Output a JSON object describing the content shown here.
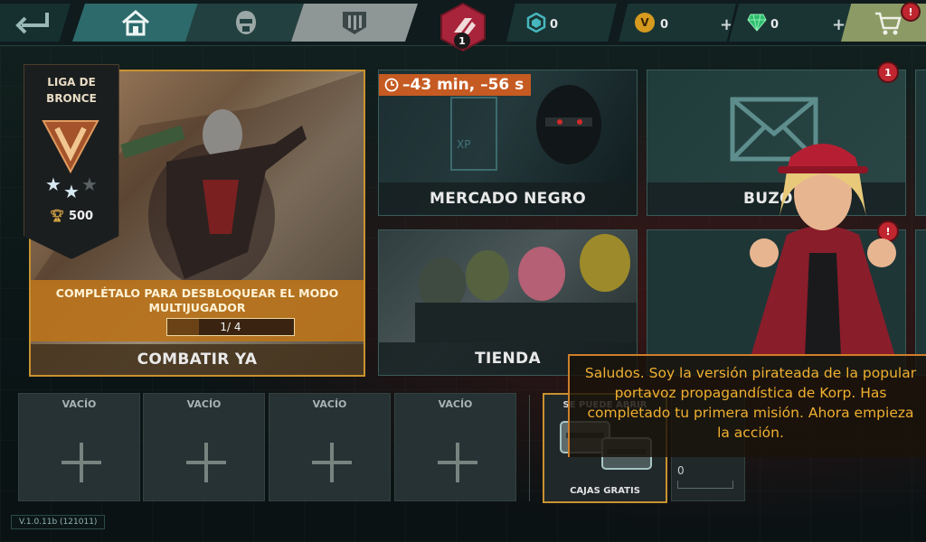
{
  "topbar": {
    "currencies": [
      {
        "name": "tokens",
        "value": "0",
        "color": "#3fa9b0"
      },
      {
        "name": "gold",
        "value": "0",
        "color": "#d59a1e"
      },
      {
        "name": "gems",
        "value": "0",
        "color": "#2dbd6e"
      }
    ],
    "plus_label": "+",
    "level_badge": "1",
    "cart_alert": "!"
  },
  "league": {
    "name_line1": "LIGA DE",
    "name_line2": "BRONCE",
    "trophies": "500",
    "stars_filled": 2,
    "stars_total": 3
  },
  "combat": {
    "unlock_text": "COMPLÉTALO PARA DESBLOQUEAR EL MODO MULTIJUGADOR",
    "progress_text": "1/ 4",
    "progress_fraction": 0.25,
    "label": "COMBATIR YA"
  },
  "market": {
    "timer": "–43 min, –56 s",
    "label": "MERCADO NEGRO"
  },
  "mailbox": {
    "label": "BUZÓ",
    "badge": "1"
  },
  "shop": {
    "label": "TIENDA"
  },
  "blank_card": {
    "badge": "!"
  },
  "slots": [
    {
      "label": "VACÍO"
    },
    {
      "label": "VACÍO"
    },
    {
      "label": "VACÍO"
    },
    {
      "label": "VACÍO"
    }
  ],
  "crates": {
    "header": "SE PUEDE ABRIR",
    "footer": "CAJAS GRATIS",
    "second_value": "0"
  },
  "version": "V.1.0.11b (121011)",
  "dialog": {
    "message": "Saludos. Soy la versión pirateada de la popular portavoz propagandística de Korp. Has completado tu primera misión. Ahora empieza la acción."
  },
  "colors": {
    "accent_orange": "#c9922f",
    "dialog_text": "#f0b030",
    "alert_red": "#c0262f"
  }
}
